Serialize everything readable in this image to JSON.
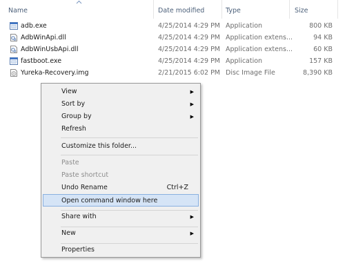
{
  "columns": {
    "name": "Name",
    "date": "Date modified",
    "type": "Type",
    "size": "Size"
  },
  "files": [
    {
      "name": "adb.exe",
      "date": "4/25/2014 4:29 PM",
      "type": "Application",
      "size": "800 KB",
      "icon": "application-icon"
    },
    {
      "name": "AdbWinApi.dll",
      "date": "4/25/2014 4:29 PM",
      "type": "Application extens...",
      "size": "94 KB",
      "icon": "dll-icon"
    },
    {
      "name": "AdbWinUsbApi.dll",
      "date": "4/25/2014 4:29 PM",
      "type": "Application extens...",
      "size": "60 KB",
      "icon": "dll-icon"
    },
    {
      "name": "fastboot.exe",
      "date": "4/25/2014 4:29 PM",
      "type": "Application",
      "size": "157 KB",
      "icon": "application-icon"
    },
    {
      "name": "Yureka-Recovery.img",
      "date": "2/21/2015 6:02 PM",
      "type": "Disc Image File",
      "size": "8,390 KB",
      "icon": "disc-image-icon"
    }
  ],
  "context_menu": {
    "view": "View",
    "sort_by": "Sort by",
    "group_by": "Group by",
    "refresh": "Refresh",
    "customize": "Customize this folder...",
    "paste": "Paste",
    "paste_shortcut": "Paste shortcut",
    "undo_rename": "Undo Rename",
    "undo_shortcut": "Ctrl+Z",
    "open_cmd": "Open command window here",
    "share_with": "Share with",
    "new": "New",
    "properties": "Properties"
  },
  "colors": {
    "menu_highlight": "#d5e4f6",
    "menu_highlight_border": "#89b0e0",
    "header_text": "#4c607a"
  }
}
